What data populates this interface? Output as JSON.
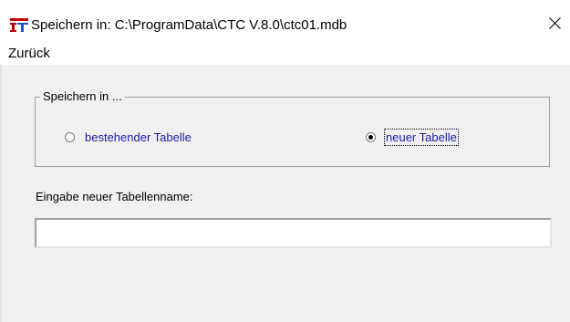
{
  "window": {
    "title": "Speichern in: C:\\ProgramData\\CTC V.8.0\\ctc01.mdb",
    "icon": "it-app-icon",
    "close_icon": "close-icon"
  },
  "menu": {
    "items": [
      {
        "label": "Zurück"
      }
    ]
  },
  "save_group": {
    "legend": "Speichern in ...",
    "options": [
      {
        "label": "bestehender Tabelle",
        "selected": false
      },
      {
        "label": "neuer Tabelle",
        "selected": true
      }
    ]
  },
  "table_name": {
    "label": "Eingabe neuer Tabellenname:",
    "value": "",
    "placeholder": ""
  },
  "colors": {
    "option_text": "#1a1aaa",
    "background": "#f0f0f0",
    "titlebar": "#ffffff"
  }
}
